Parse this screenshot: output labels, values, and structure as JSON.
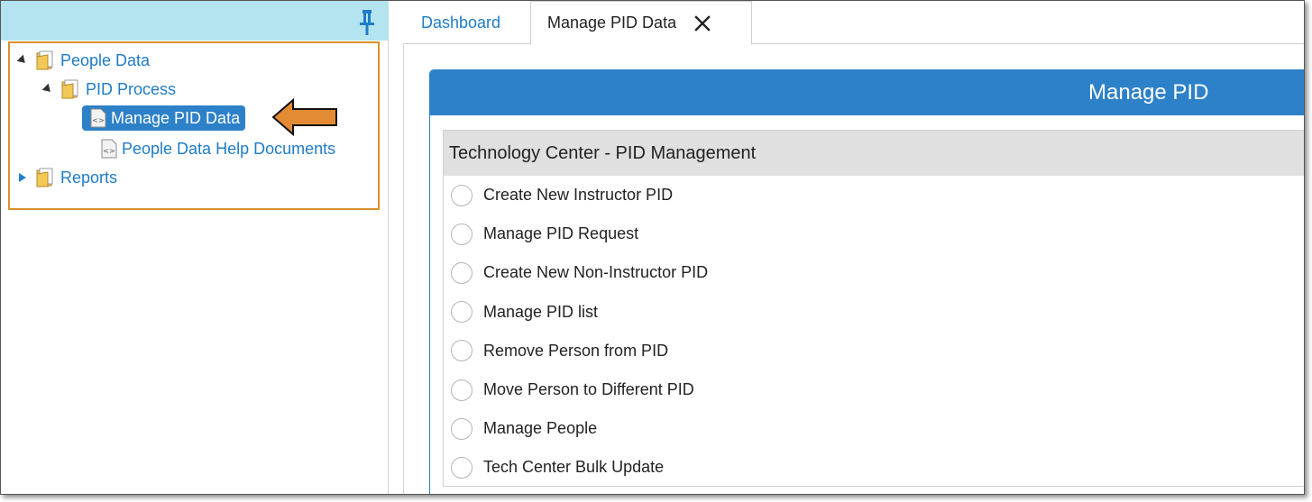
{
  "sidebar": {
    "tree": {
      "people_data": "People Data",
      "pid_process": "PID Process",
      "manage_pid_data": "Manage PID Data",
      "help_documents": "People Data Help Documents",
      "reports": "Reports"
    },
    "highlight_color": "#d8912d",
    "pin_bar_color": "#b4e4f0"
  },
  "tabs": {
    "dashboard": "Dashboard",
    "active": "Manage PID Data"
  },
  "card": {
    "title": "Manage PID",
    "section_title": "Technology Center - PID Management",
    "options": [
      "Create New Instructor PID",
      "Manage PID Request",
      "Create New Non-Instructor PID",
      "Manage PID list",
      "Remove Person from PID",
      "Move Person to Different PID",
      "Manage People",
      "Tech Center Bulk Update"
    ]
  },
  "colors": {
    "accent": "#2d81c8",
    "link": "#1f7cc7",
    "callout_arrow": "#e38a35"
  },
  "icons": {
    "pin": "pin-icon",
    "folder": "folder-icon",
    "document": "document-icon",
    "close": "close-icon",
    "arrow": "arrow-left-icon"
  }
}
